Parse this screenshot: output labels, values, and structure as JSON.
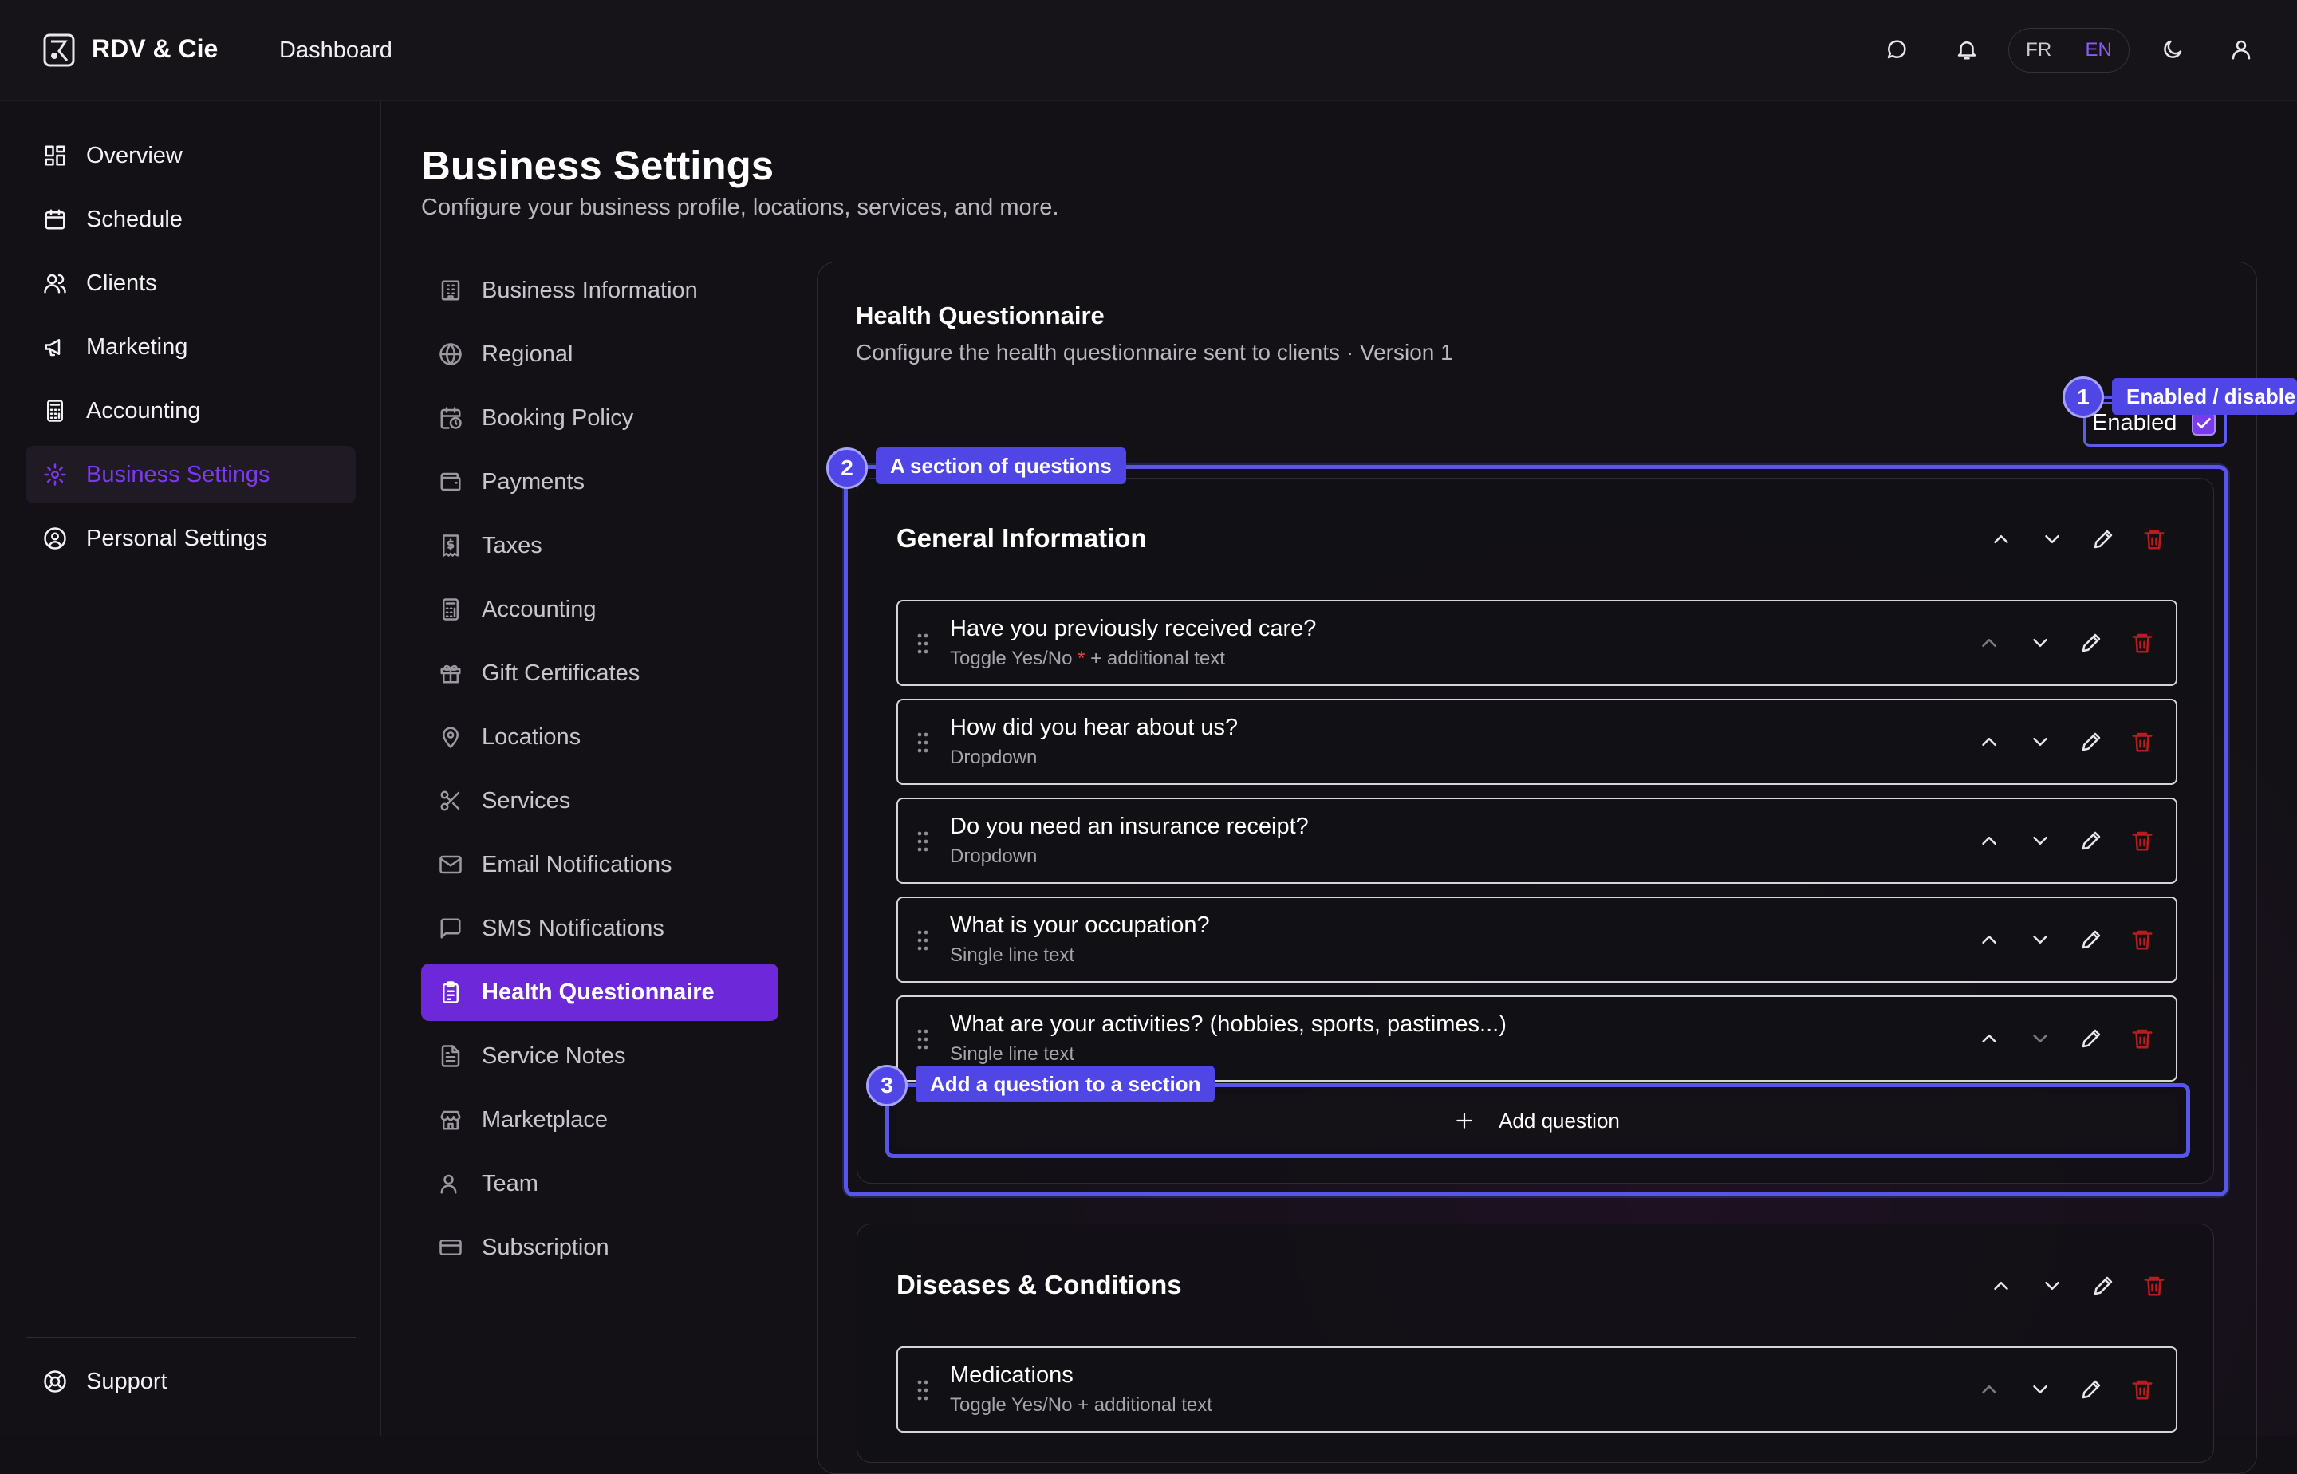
{
  "app": {
    "name": "RDV & Cie",
    "breadcrumb": "Dashboard"
  },
  "header": {
    "lang_fr": "FR",
    "lang_en": "EN",
    "icons": [
      "chat-icon",
      "bell-icon",
      "moon-icon",
      "user-icon"
    ]
  },
  "sidebar": {
    "items": [
      {
        "label": "Overview",
        "icon": "grid-icon"
      },
      {
        "label": "Schedule",
        "icon": "calendar-icon"
      },
      {
        "label": "Clients",
        "icon": "users-icon"
      },
      {
        "label": "Marketing",
        "icon": "megaphone-icon"
      },
      {
        "label": "Accounting",
        "icon": "calculator-icon"
      },
      {
        "label": "Business Settings",
        "icon": "gear-icon",
        "active": true
      },
      {
        "label": "Personal Settings",
        "icon": "user-circle-icon"
      }
    ],
    "support": "Support"
  },
  "page": {
    "title": "Business Settings",
    "subtitle": "Configure your business profile, locations, services, and more."
  },
  "settings_nav": {
    "items": [
      {
        "label": "Business Information",
        "icon": "building-icon"
      },
      {
        "label": "Regional",
        "icon": "globe-icon"
      },
      {
        "label": "Booking Policy",
        "icon": "calendar-clock-icon"
      },
      {
        "label": "Payments",
        "icon": "wallet-icon"
      },
      {
        "label": "Taxes",
        "icon": "receipt-icon"
      },
      {
        "label": "Accounting",
        "icon": "calculator-icon"
      },
      {
        "label": "Gift Certificates",
        "icon": "gift-icon"
      },
      {
        "label": "Locations",
        "icon": "map-pin-icon"
      },
      {
        "label": "Services",
        "icon": "scissors-icon"
      },
      {
        "label": "Email Notifications",
        "icon": "mail-icon"
      },
      {
        "label": "SMS Notifications",
        "icon": "message-square-icon"
      },
      {
        "label": "Health Questionnaire",
        "icon": "clipboard-icon",
        "active": true
      },
      {
        "label": "Service Notes",
        "icon": "file-text-icon"
      },
      {
        "label": "Marketplace",
        "icon": "store-icon"
      },
      {
        "label": "Team",
        "icon": "users-icon"
      },
      {
        "label": "Subscription",
        "icon": "credit-card-icon"
      }
    ]
  },
  "questionnaire": {
    "title": "Health Questionnaire",
    "subtitle": "Configure the health questionnaire sent to clients · Version 1",
    "enabled_label": "Enabled",
    "enabled": true,
    "sections": [
      {
        "title": "General Information",
        "questions": [
          {
            "title": "Have you previously received care?",
            "type": "Toggle Yes/No",
            "required": true,
            "extra": "+ additional text"
          },
          {
            "title": "How did you hear about us?",
            "type": "Dropdown"
          },
          {
            "title": "Do you need an insurance receipt?",
            "type": "Dropdown"
          },
          {
            "title": "What is your occupation?",
            "type": "Single line text"
          },
          {
            "title": "What are your activities? (hobbies, sports, pastimes...)",
            "type": "Single line text"
          }
        ],
        "add_label": "Add question"
      },
      {
        "title": "Diseases & Conditions",
        "questions": [
          {
            "title": "Medications",
            "type": "Toggle Yes/No + additional text"
          }
        ]
      }
    ]
  },
  "callouts": [
    {
      "number": "1",
      "label": "Enabled / disable"
    },
    {
      "number": "2",
      "label": "A section of questions"
    },
    {
      "number": "3",
      "label": "Add a question to a section"
    }
  ],
  "colors": {
    "accent": "#6d28d9",
    "callout": "#4f46e5",
    "danger": "#b91c1c"
  }
}
